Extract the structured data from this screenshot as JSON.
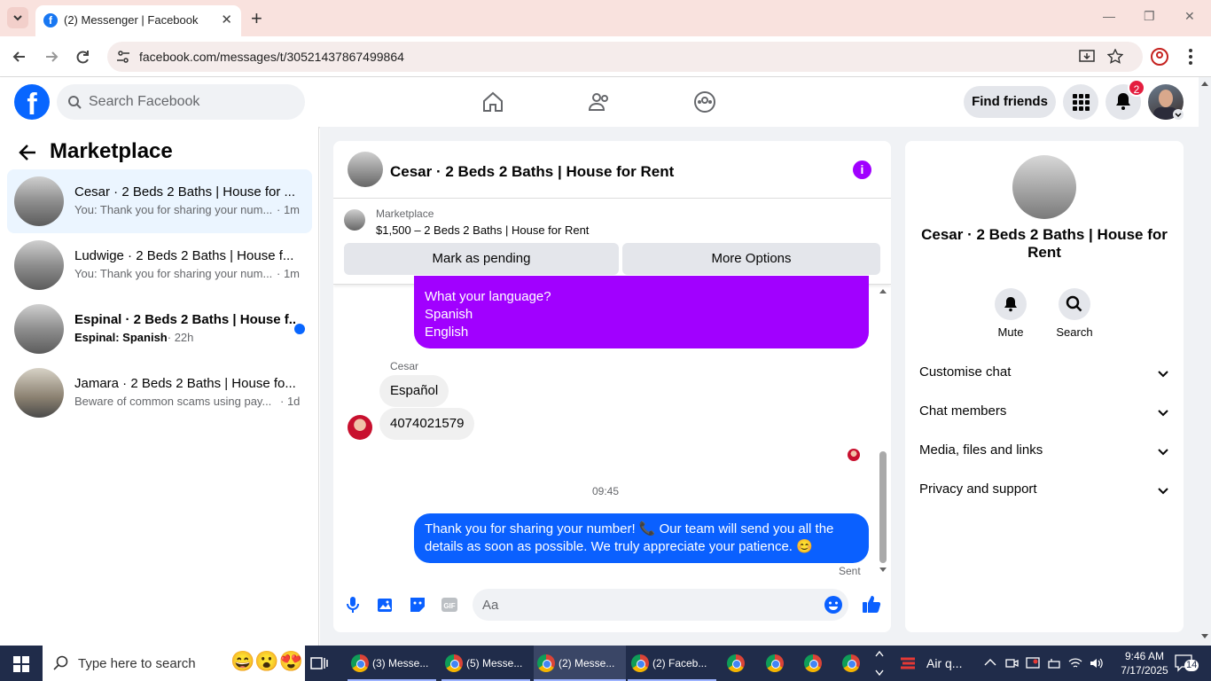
{
  "browser": {
    "tab_title": "(2) Messenger | Facebook",
    "url": "facebook.com/messages/t/30521437867499864"
  },
  "fb": {
    "search_placeholder": "Search Facebook",
    "find_friends": "Find friends",
    "notif_count": "2"
  },
  "sidebar": {
    "title": "Marketplace",
    "conversations": [
      {
        "name": "Cesar · 2 Beds 2 Baths | House for ...",
        "snippet": "You: Thank you for sharing your num...",
        "time": "· 1m",
        "active": true
      },
      {
        "name": "Ludwige · 2 Beds 2 Baths | House f...",
        "snippet": "You: Thank you for sharing your num...",
        "time": "· 1m"
      },
      {
        "name": "Espinal · 2 Beds 2 Baths | House f...",
        "snippet_bold": "Espinal: Spanish",
        "time": "· 22h",
        "unread": true
      },
      {
        "name": "Jamara · 2 Beds 2 Baths | House fo...",
        "snippet": "Beware of common scams using pay...",
        "time": "· 1d"
      }
    ]
  },
  "chat": {
    "title": "Cesar · 2 Beds 2 Baths | House for Rent",
    "listing_label": "Marketplace",
    "listing_price": "$1,500 – 2 Beds 2 Baths | House for Rent",
    "mark_pending": "Mark as pending",
    "more_options": "More Options",
    "messages": {
      "purple_lines": [
        "What your language?",
        "Spanish",
        "English"
      ],
      "sender": "Cesar",
      "reply1": "Español",
      "reply2": "4074021579",
      "time_divider": "09:45",
      "outgoing": "Thank you for sharing your number! 📞 Our team will send you all the details as soon as possible. We truly appreciate your patience. 😊",
      "status": "Sent"
    },
    "input_placeholder": "Aa"
  },
  "info": {
    "name": "Cesar · 2 Beds 2 Baths | House for Rent",
    "mute": "Mute",
    "search": "Search",
    "rows": [
      "Customise chat",
      "Chat members",
      "Media, files and links",
      "Privacy and support"
    ]
  },
  "taskbar": {
    "search_placeholder": "Type here to search",
    "apps": [
      "(3) Messe...",
      "(5) Messe...",
      "(2) Messe...",
      "(2) Faceb..."
    ],
    "weather": "Air q...",
    "time": "9:46 AM",
    "date": "7/17/2025",
    "notif_count": "14"
  }
}
